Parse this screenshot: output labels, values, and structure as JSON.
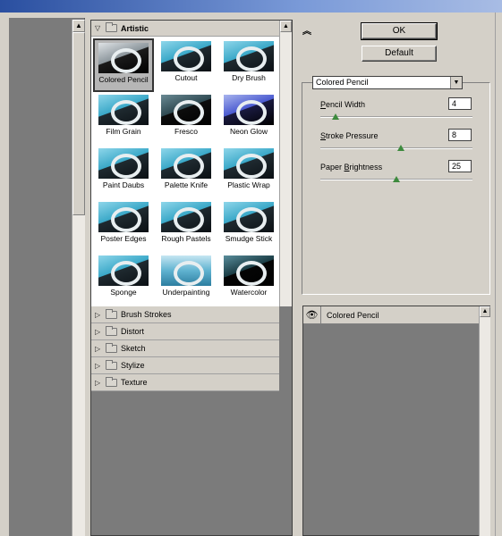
{
  "gallery": {
    "open_category": "Artistic",
    "filters": [
      {
        "label": "Colored Pencil",
        "selected": true
      },
      {
        "label": "Cutout"
      },
      {
        "label": "Dry Brush"
      },
      {
        "label": "Film Grain"
      },
      {
        "label": "Fresco"
      },
      {
        "label": "Neon Glow"
      },
      {
        "label": "Paint Daubs"
      },
      {
        "label": "Palette Knife"
      },
      {
        "label": "Plastic Wrap"
      },
      {
        "label": "Poster Edges"
      },
      {
        "label": "Rough Pastels"
      },
      {
        "label": "Smudge Stick"
      },
      {
        "label": "Sponge"
      },
      {
        "label": "Underpainting"
      },
      {
        "label": "Watercolor"
      }
    ],
    "categories": [
      "Brush Strokes",
      "Distort",
      "Sketch",
      "Stylize",
      "Texture"
    ]
  },
  "buttons": {
    "ok": "OK",
    "default": "Default"
  },
  "filter_select": {
    "value": "Colored Pencil"
  },
  "params": [
    {
      "label_prefix": "",
      "label_key": "P",
      "label_rest": "encil Width",
      "value": "4",
      "level": 0.1
    },
    {
      "label_prefix": "",
      "label_key": "S",
      "label_rest": "troke Pressure",
      "value": "8",
      "level": 0.53
    },
    {
      "label_prefix": "Paper ",
      "label_key": "B",
      "label_rest": "rightness",
      "value": "25",
      "level": 0.5
    }
  ],
  "layers": {
    "items": [
      {
        "name": "Colored Pencil"
      }
    ]
  },
  "colors": {
    "panel_bg": "#d4d0c8",
    "preview_bg": "#7b7b7b",
    "slider_knob": "#3d8a3d",
    "title_bar": "#2a4fa0"
  }
}
